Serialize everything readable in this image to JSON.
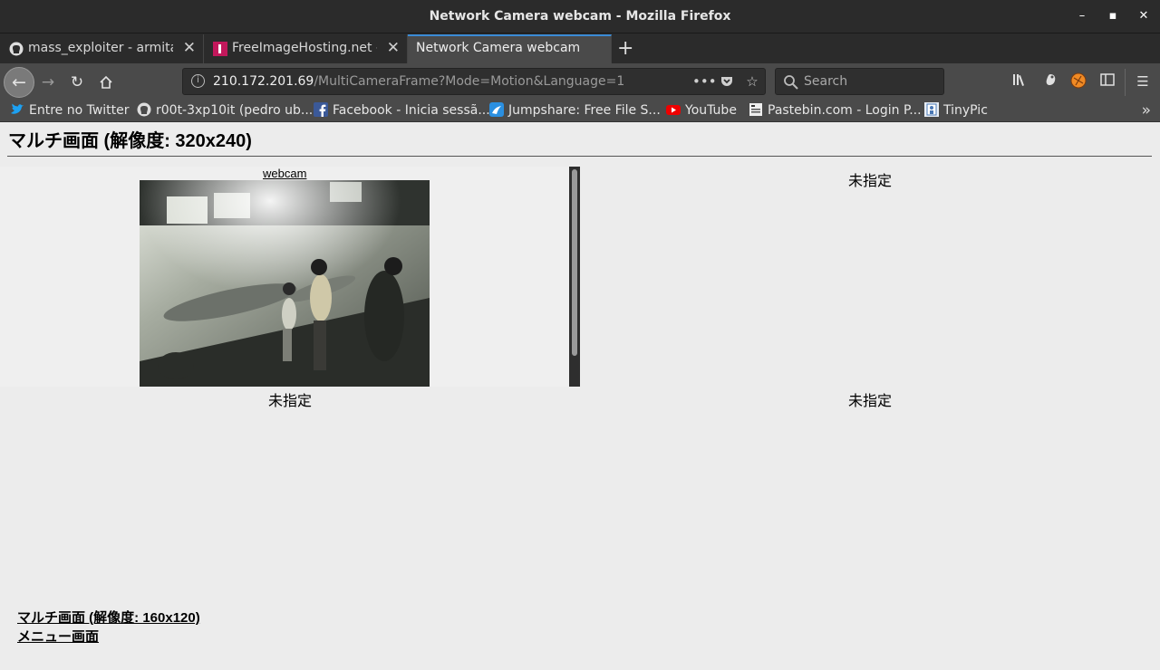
{
  "window": {
    "title": "Network Camera webcam - Mozilla Firefox"
  },
  "tabs": [
    {
      "label": "mass_exploiter - armitag",
      "icon": "github-icon"
    },
    {
      "label": "FreeImageHosting.net - I",
      "icon": "freeimagehosting-icon"
    },
    {
      "label": "Network Camera webcam",
      "icon": "none",
      "active": true
    }
  ],
  "navbar": {
    "url_host": "210.172.201.69",
    "url_path": "/MultiCameraFrame?Mode=Motion&Language=1",
    "search_placeholder": "Search"
  },
  "bookmarks": [
    {
      "label": "Entre no Twitter",
      "icon": "twitter-icon"
    },
    {
      "label": "r00t-3xp10it (pedro ub...",
      "icon": "github-icon"
    },
    {
      "label": "Facebook - Inicia sessã...",
      "icon": "facebook-icon"
    },
    {
      "label": "Jumpshare: Free File S...",
      "icon": "jumpshare-icon"
    },
    {
      "label": "YouTube",
      "icon": "youtube-icon"
    },
    {
      "label": "Pastebin.com - Login P...",
      "icon": "pastebin-icon"
    },
    {
      "label": "TinyPic",
      "icon": "tinypic-icon"
    }
  ],
  "page": {
    "heading": "マルチ画面 (解像度: 320x240)",
    "camera1_link": "webcam",
    "unassigned": [
      "未指定",
      "未指定",
      "未指定"
    ],
    "links": {
      "multi_small": "マルチ画面 (解像度: 160x120)",
      "menu": "メニュー画面"
    }
  },
  "colors": {
    "chrome_dark": "#2b2b2b",
    "toolbar": "#4a4a4a",
    "active_tab_accent": "#3a8bd6",
    "page_bg": "#ececec"
  }
}
